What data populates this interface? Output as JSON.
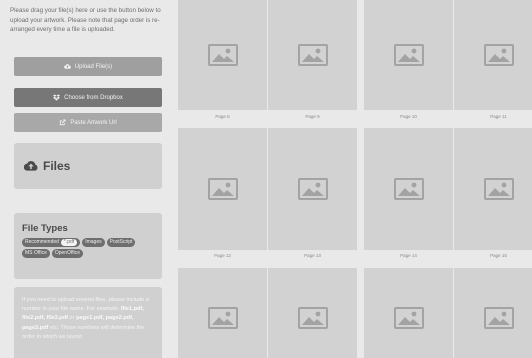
{
  "sidebar": {
    "intro_text": "Please drag your file(s) here or use the button below to upload your artwork. Please note that page order is re-arranged every time a file is uploaded.",
    "upload_button": "Upload File(s)",
    "dropbox_button": "Choose from Dropbox",
    "paste_button": "Paste Artwork Url",
    "files_title": "Files",
    "file_types": {
      "title": "File Types",
      "recommended_label": "Recommended",
      "recommended_value": "*.pdf",
      "chips": [
        "Images",
        "PostScript",
        "MS Office",
        "OpenOffice"
      ]
    },
    "help": {
      "line1": "If you need to upload several files, please include a number in your file name. For example: ",
      "examples_a": "file1.pdf, file2.pdf, file3.pdf",
      "or_text": " or ",
      "examples_b": "page1.pdf, page2.pdf, page3.pdf",
      "line2": " etc. Those numbers will determine the order in which we layout"
    }
  },
  "pages": {
    "row1": [
      "Page 8",
      "Page 9",
      "Page 10",
      "Page 11"
    ],
    "row2": [
      "Page 12",
      "Page 13",
      "Page 14",
      "Page 15"
    ],
    "row3": [
      "",
      "",
      "",
      ""
    ]
  },
  "icons": {
    "upload": "cloud-upload-icon",
    "dropbox": "dropbox-icon",
    "paste": "external-link-icon",
    "files": "cloud-icon",
    "placeholder": "image-placeholder-icon"
  }
}
